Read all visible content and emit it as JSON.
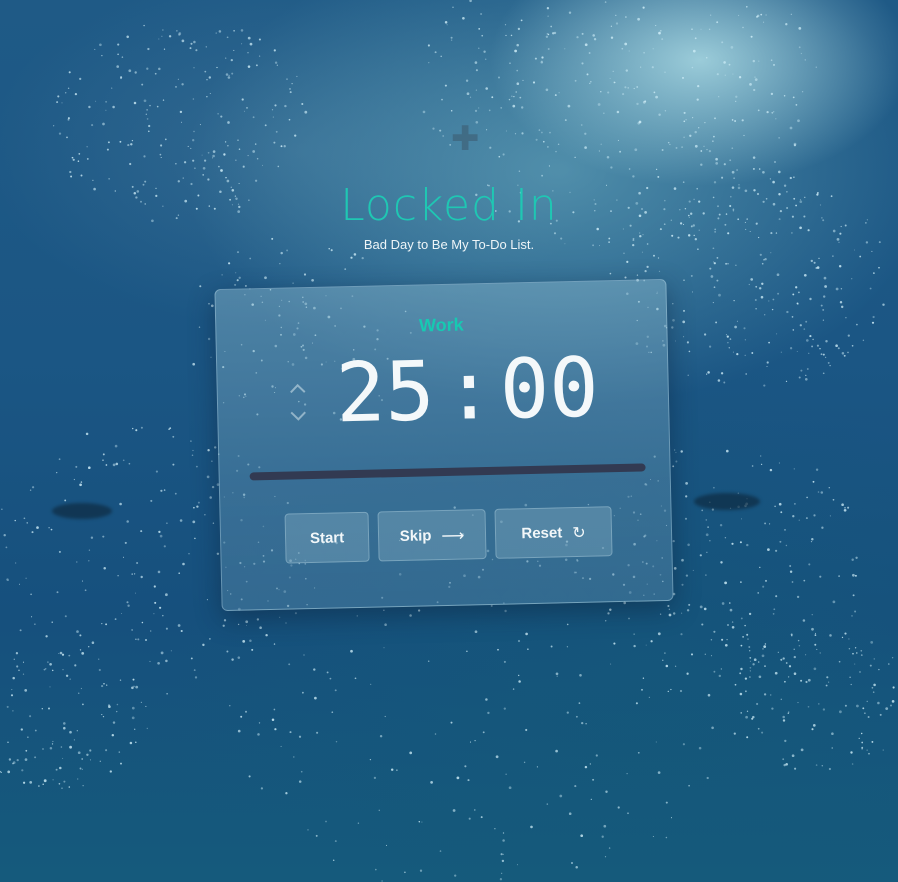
{
  "header": {
    "title": "Locked In",
    "subtitle": "Bad Day to Be My To-Do List."
  },
  "timer": {
    "mode": "Work",
    "minutes": "25",
    "separator": ":",
    "seconds": "00",
    "progress": 0
  },
  "stepper": {
    "up_icon": "chevron-up-icon",
    "down_icon": "chevron-down-icon"
  },
  "controls": {
    "start_label": "Start",
    "skip_label": "Skip",
    "skip_icon": "arrow-right-icon",
    "reset_label": "Reset",
    "reset_icon": "refresh-icon"
  },
  "colors": {
    "accent": "#17c9b2",
    "progress_track": "#323a52",
    "text": "#f4f8fa"
  }
}
